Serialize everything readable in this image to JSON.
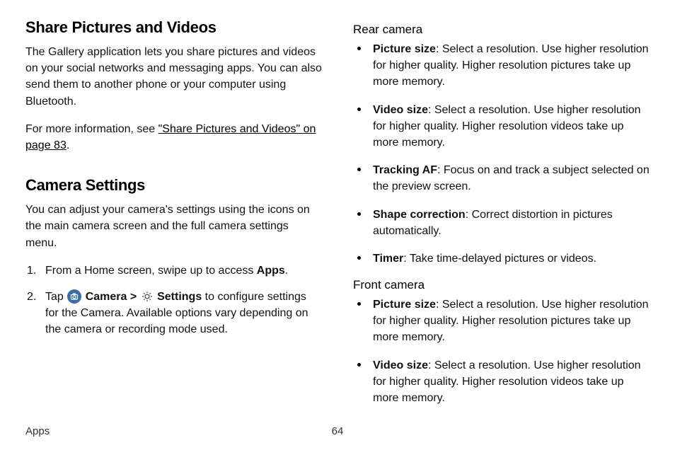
{
  "left": {
    "section1_heading": "Share Pictures and Videos",
    "section1_p1": "The Gallery application lets you share pictures and videos on your social networks and messaging apps. You can also send them to another phone or your computer using Bluetooth.",
    "section1_p2_pre": "For more information, see ",
    "section1_p2_link": "\"Share Pictures and Videos\" on page 83",
    "section1_p2_post": ".",
    "section2_heading": "Camera Settings",
    "section2_p1": "You can adjust your camera's settings using the icons on the main camera screen and the full camera settings menu.",
    "step1_pre": "From a Home screen, swipe up to access ",
    "step1_bold": "Apps",
    "step1_post": ".",
    "step2_pre": "Tap ",
    "step2_camera": "Camera",
    "step2_gt": " > ",
    "step2_settings": "Settings",
    "step2_post": " to configure settings for the Camera. Available options vary depending on the camera or recording mode used."
  },
  "right": {
    "rear_heading": "Rear camera",
    "front_heading": "Front camera",
    "rear_items": [
      {
        "bold": "Picture size",
        "text": ": Select a resolution. Use higher resolution for higher quality. Higher resolution pictures take up more memory."
      },
      {
        "bold": "Video size",
        "text": ": Select a resolution. Use higher resolution for higher quality. Higher resolution videos take up more memory."
      },
      {
        "bold": "Tracking AF",
        "text": ": Focus on and track a subject selected on the preview screen."
      },
      {
        "bold": "Shape correction",
        "text": ": Correct distortion in pictures automatically."
      },
      {
        "bold": "Timer",
        "text": ": Take time-delayed pictures or videos."
      }
    ],
    "front_items": [
      {
        "bold": "Picture size",
        "text": ": Select a resolution. Use higher resolution for higher quality. Higher resolution pictures take up more memory."
      },
      {
        "bold": "Video size",
        "text": ": Select a resolution. Use higher resolution for higher quality. Higher resolution videos take up more memory."
      }
    ]
  },
  "footer": {
    "section": "Apps",
    "page": "64"
  }
}
